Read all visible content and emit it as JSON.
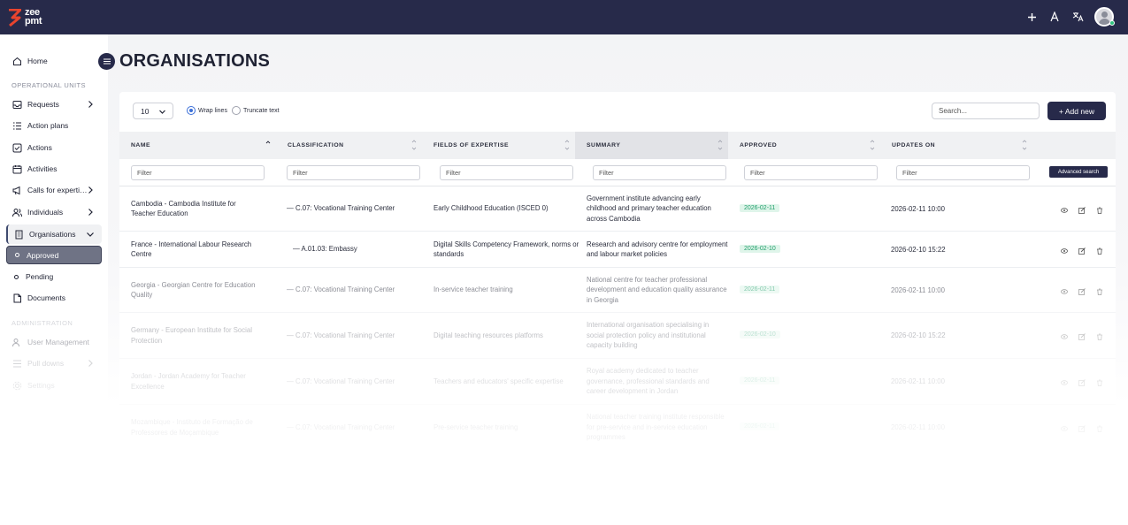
{
  "brand": {
    "logo_text_line1": "zee",
    "logo_text_line2": "pmt",
    "accent": "#272a4a",
    "logo_color": "#e8442e"
  },
  "topbar": {
    "icons": [
      "plus-icon",
      "font-size-icon",
      "translate-icon",
      "user-avatar"
    ]
  },
  "sidebar": {
    "home": "Home",
    "section_operational": "OPERATIONAL UNITS",
    "items": [
      {
        "label": "Requests",
        "icon": "inbox-icon",
        "has_chevron": true
      },
      {
        "label": "Action plans",
        "icon": "list-icon",
        "has_chevron": false
      },
      {
        "label": "Actions",
        "icon": "checkbox-icon",
        "has_chevron": false
      },
      {
        "label": "Activities",
        "icon": "calendar-icon",
        "has_chevron": false
      },
      {
        "label": "Calls for experti…",
        "icon": "megaphone-icon",
        "has_chevron": true
      },
      {
        "label": "Individuals",
        "icon": "users-icon",
        "has_chevron": true
      },
      {
        "label": "Organisations",
        "icon": "building-icon",
        "has_chevron": true
      }
    ],
    "sub_items": [
      "Approved",
      "Pending"
    ],
    "documents": "Documents",
    "section_admin": "ADMINISTRATION",
    "admin_items": [
      "User Management",
      "Pull downs",
      "Settings"
    ]
  },
  "page": {
    "title": "ORGANISATIONS"
  },
  "toolbar": {
    "page_size": "10",
    "wrap_label": "Wrap lines",
    "truncate_label": "Truncate text",
    "search_placeholder": "Search...",
    "add_label": "+ Add new",
    "advanced_label": "Advanced search",
    "filter_placeholder": "Filter"
  },
  "columns": [
    "NAME",
    "CLASSIFICATION",
    "FIELDS OF EXPERTISE",
    "SUMMARY",
    "APPROVED",
    "UPDATES ON"
  ],
  "rows": [
    {
      "name": "Cambodia - Cambodia Institute for Teacher Education",
      "classification": "— C.07: Vocational Training Center",
      "fields": "Early Childhood Education (ISCED 0)",
      "summary": "Government institute advancing early childhood and primary teacher education across Cambodia",
      "approved": "2026-02-11",
      "updated": "2026-02-11 10:00"
    },
    {
      "name": "France - International Labour Research Centre",
      "classification": "— A.01.03: Embassy",
      "fields": "Digital Skills Competency Framework, norms or standards",
      "summary": "Research and advisory centre for employment and labour market policies",
      "approved": "2026-02-10",
      "updated": "2026-02-10 15:22"
    },
    {
      "name": "Georgia - Georgian Centre for Education Quality",
      "classification": "— C.07: Vocational Training Center",
      "fields": "In-service teacher training",
      "summary": "National centre for teacher professional development and education quality assurance in Georgia",
      "approved": "2026-02-11",
      "updated": "2026-02-11 10:00"
    },
    {
      "name": "Germany - European Institute for Social Protection",
      "classification": "— C.07: Vocational Training Center",
      "fields": "Digital teaching resources platforms",
      "summary": "International organisation specialising in social protection policy and institutional capacity building",
      "approved": "2026-02-10",
      "updated": "2026-02-10 15:22"
    },
    {
      "name": "Jordan - Jordan Academy for Teacher Excellence",
      "classification": "— C.07: Vocational Training Center",
      "fields": "Teachers and educators' specific expertise",
      "summary": "Royal academy dedicated to teacher governance, professional standards and career development in Jordan",
      "approved": "2026-02-11",
      "updated": "2026-02-11 10:00"
    },
    {
      "name": "Mozambique - Instituto de Formação de Professores de Moçambique",
      "classification": "— C.07: Vocational Training Center",
      "fields": "Pre-service teacher training",
      "summary": "National teacher training institute responsible for pre-service and in-service education programmes",
      "approved": "2026-02-11",
      "updated": "2026-02-11 10:00"
    }
  ]
}
